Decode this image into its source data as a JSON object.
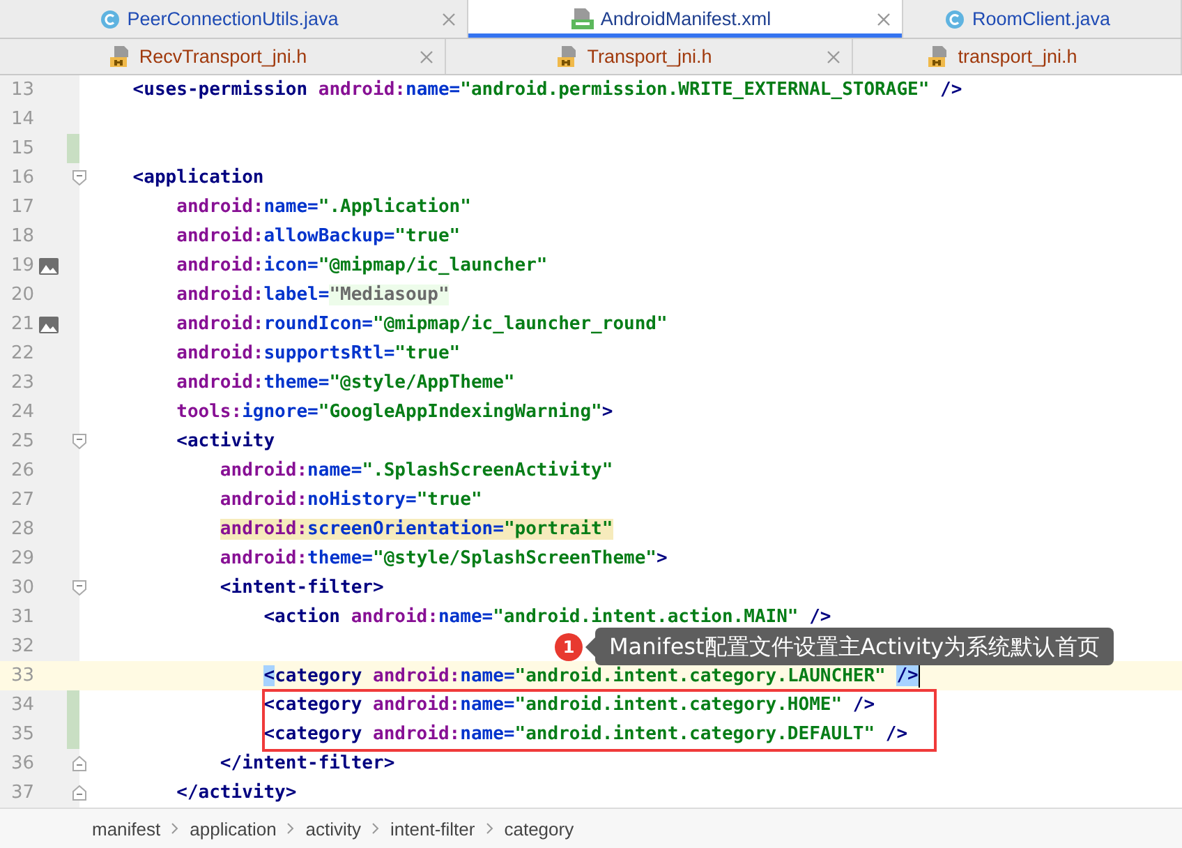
{
  "tab_rows": [
    {
      "tabs": [
        {
          "label": "PeerConnectionUtils.java",
          "kind": "class",
          "color": "#1f4bb4",
          "selected": false,
          "closable": true
        },
        {
          "label": "AndroidManifest.xml",
          "kind": "manifest",
          "color": "#1f3f8f",
          "selected": true,
          "closable": true
        },
        {
          "label": "RoomClient.java",
          "kind": "class",
          "color": "#1f4bb4",
          "selected": false,
          "closable": false
        }
      ]
    },
    {
      "tabs": [
        {
          "label": "RecvTransport_jni.h",
          "kind": "header",
          "color": "#a0390c",
          "selected": false,
          "closable": true
        },
        {
          "label": "Transport_jni.h",
          "kind": "header",
          "color": "#a0390c",
          "selected": false,
          "closable": true
        },
        {
          "label": "transport_jni.h",
          "kind": "header",
          "color": "#a0390c",
          "selected": false,
          "closable": false
        }
      ]
    }
  ],
  "editor": {
    "lines": [
      {
        "number": "13",
        "tokens": [
          {
            "kind": "tag",
            "text": "    <uses-permission "
          },
          {
            "kind": "ns",
            "text": "android:"
          },
          {
            "kind": "attr",
            "text": "name="
          },
          {
            "kind": "str",
            "text": "\"android.permission.WRITE_EXTERNAL_STORAGE\""
          },
          {
            "kind": "tag",
            "text": " />"
          }
        ]
      },
      {
        "number": "14"
      },
      {
        "number": "15",
        "changed": true
      },
      {
        "number": "16",
        "fold_start": true,
        "tokens": [
          {
            "kind": "tag",
            "text": "    <application"
          }
        ]
      },
      {
        "number": "17",
        "tokens": [
          {
            "kind": "ns",
            "text": "        android:"
          },
          {
            "kind": "attr",
            "text": "name="
          },
          {
            "kind": "str",
            "text": "\".Application\""
          }
        ]
      },
      {
        "number": "18",
        "tokens": [
          {
            "kind": "ns",
            "text": "        android:"
          },
          {
            "kind": "attr",
            "text": "allowBackup="
          },
          {
            "kind": "str",
            "text": "\"true\""
          }
        ]
      },
      {
        "number": "19",
        "image_marker": true,
        "tokens": [
          {
            "kind": "ns",
            "text": "        android:"
          },
          {
            "kind": "attr",
            "text": "icon="
          },
          {
            "kind": "str",
            "text": "\"@mipmap/ic_launcher\""
          }
        ]
      },
      {
        "number": "20",
        "tokens": [
          {
            "kind": "ns",
            "text": "        android:"
          },
          {
            "kind": "attr",
            "text": "label="
          },
          {
            "kind": "str",
            "text": "\"Mediasoup\"",
            "hardcoded": true
          }
        ]
      },
      {
        "number": "21",
        "image_marker": true,
        "tokens": [
          {
            "kind": "ns",
            "text": "        android:"
          },
          {
            "kind": "attr",
            "text": "roundIcon="
          },
          {
            "kind": "str",
            "text": "\"@mipmap/ic_launcher_round\""
          }
        ]
      },
      {
        "number": "22",
        "tokens": [
          {
            "kind": "ns",
            "text": "        android:"
          },
          {
            "kind": "attr",
            "text": "supportsRtl="
          },
          {
            "kind": "str",
            "text": "\"true\""
          }
        ]
      },
      {
        "number": "23",
        "tokens": [
          {
            "kind": "ns",
            "text": "        android:"
          },
          {
            "kind": "attr",
            "text": "theme="
          },
          {
            "kind": "str",
            "text": "\"@style/AppTheme\""
          }
        ]
      },
      {
        "number": "24",
        "tokens": [
          {
            "kind": "ns",
            "text": "        tools:"
          },
          {
            "kind": "attr",
            "text": "ignore="
          },
          {
            "kind": "str",
            "text": "\"GoogleAppIndexingWarning\""
          },
          {
            "kind": "tag",
            "text": ">"
          }
        ]
      },
      {
        "number": "25",
        "fold_start": true,
        "tokens": [
          {
            "kind": "tag",
            "text": "        <activity"
          }
        ]
      },
      {
        "number": "26",
        "tokens": [
          {
            "kind": "ns",
            "text": "            android:"
          },
          {
            "kind": "attr",
            "text": "name="
          },
          {
            "kind": "str",
            "text": "\".SplashScreenActivity\""
          }
        ]
      },
      {
        "number": "27",
        "tokens": [
          {
            "kind": "ns",
            "text": "            android:"
          },
          {
            "kind": "attr",
            "text": "noHistory="
          },
          {
            "kind": "str",
            "text": "\"true\""
          }
        ]
      },
      {
        "number": "28",
        "tokens": [
          {
            "kind": "ns",
            "text": "            android:",
            "warning": true
          },
          {
            "kind": "attr",
            "text": "screenOrientation=",
            "warning": true
          },
          {
            "kind": "str",
            "text": "\"portrait\"",
            "warning": true
          }
        ]
      },
      {
        "number": "29",
        "tokens": [
          {
            "kind": "ns",
            "text": "            android:"
          },
          {
            "kind": "attr",
            "text": "theme="
          },
          {
            "kind": "str",
            "text": "\"@style/SplashScreenTheme\""
          },
          {
            "kind": "tag",
            "text": ">"
          }
        ]
      },
      {
        "number": "30",
        "fold_start": true,
        "tokens": [
          {
            "kind": "tag",
            "text": "            <intent-filter>"
          }
        ]
      },
      {
        "number": "31",
        "tokens": [
          {
            "kind": "tag",
            "text": "                <action "
          },
          {
            "kind": "ns",
            "text": "android:"
          },
          {
            "kind": "attr",
            "text": "name="
          },
          {
            "kind": "str",
            "text": "\"android.intent.action.MAIN\""
          },
          {
            "kind": "tag",
            "text": " />"
          }
        ]
      },
      {
        "number": "32"
      },
      {
        "number": "33",
        "current": true,
        "tokens": [
          {
            "kind": "tag",
            "text": "                <",
            "matched": true
          },
          {
            "kind": "tag",
            "text": "category "
          },
          {
            "kind": "ns",
            "text": "android:"
          },
          {
            "kind": "attr",
            "text": "name="
          },
          {
            "kind": "str",
            "text": "\"android.intent.category.LAUNCHER\""
          },
          {
            "kind": "tag",
            "text": " />",
            "matched": true
          }
        ]
      },
      {
        "number": "34",
        "changed": true,
        "boxed": true,
        "tokens": [
          {
            "kind": "tag",
            "text": "                <category "
          },
          {
            "kind": "ns",
            "text": "android:"
          },
          {
            "kind": "attr",
            "text": "name="
          },
          {
            "kind": "str",
            "text": "\"android.intent.category.HOME\""
          },
          {
            "kind": "tag",
            "text": " />"
          }
        ]
      },
      {
        "number": "35",
        "changed": true,
        "boxed": true,
        "tokens": [
          {
            "kind": "tag",
            "text": "                <category "
          },
          {
            "kind": "ns",
            "text": "android:"
          },
          {
            "kind": "attr",
            "text": "name="
          },
          {
            "kind": "str",
            "text": "\"android.intent.category.DEFAULT\""
          },
          {
            "kind": "tag",
            "text": " />"
          }
        ]
      },
      {
        "number": "36",
        "fold_end": true,
        "tokens": [
          {
            "kind": "tag",
            "text": "            </intent-filter>"
          }
        ]
      },
      {
        "number": "37",
        "fold_end": true,
        "tokens": [
          {
            "kind": "tag",
            "text": "        </activity>"
          }
        ]
      }
    ],
    "annotation": {
      "badge": "1",
      "text": "Manifest配置文件设置主Activity为系统默认首页"
    }
  },
  "breadcrumb": [
    "manifest",
    "application",
    "activity",
    "intent-filter",
    "category"
  ]
}
